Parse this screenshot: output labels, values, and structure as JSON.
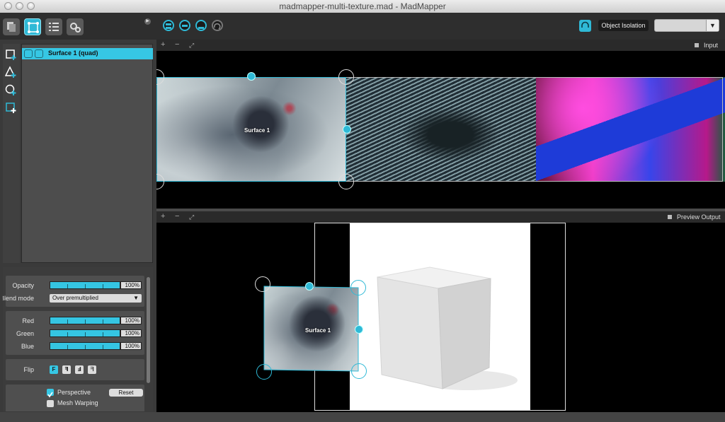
{
  "window": {
    "title": "madmapper-multi-texture.mad - MadMapper"
  },
  "toolbar": {
    "object_isolation_label": "Object Isolation",
    "isolation_select_value": ""
  },
  "layers": [
    {
      "name": "Surface 1 (quad)"
    }
  ],
  "properties": {
    "opacity_label": "Opacity",
    "opacity_value": "100%",
    "opacity": 1.0,
    "blend_label": "Blend mode",
    "blend_value": "Over premultiplied",
    "red_label": "Red",
    "red_value": "100%",
    "green_label": "Green",
    "green_value": "100%",
    "blue_label": "Blue",
    "blue_value": "100%",
    "flip_label": "Flip",
    "perspective_label": "Perspective",
    "perspective_checked": true,
    "reset_label": "Reset",
    "mesh_warping_label": "Mesh Warping"
  },
  "input_view": {
    "label": "Input",
    "surface_label": "Surface 1"
  },
  "output_view": {
    "label": "Preview Output",
    "surface_label": "Surface 1"
  },
  "colors": {
    "accent": "#2fb9d6",
    "panel": "#3a3a3a",
    "viewport": "#000000"
  }
}
